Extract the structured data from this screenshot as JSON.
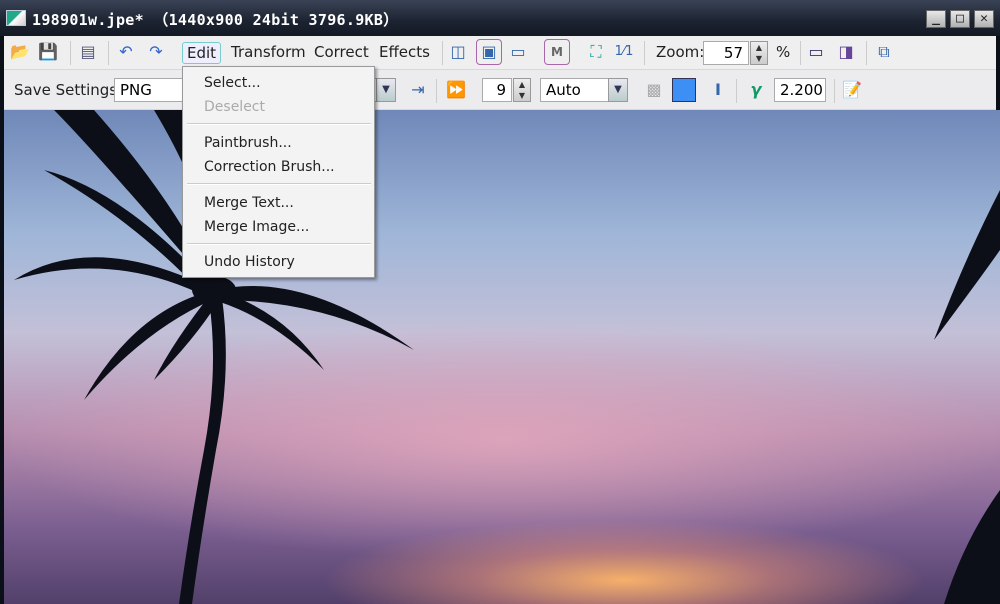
{
  "window": {
    "title": "198901w.jpe* （1440x900  24bit  3796.9KB）",
    "minimize": "_",
    "maximize": "□",
    "close": "✕"
  },
  "menubar": {
    "edit": "Edit",
    "transform": "Transform",
    "correct": "Correct",
    "effects": "Effects"
  },
  "toolbar": {
    "zoom_label": "Zoom:",
    "zoom_value": "57",
    "zoom_unit": "%",
    "m_label": "M",
    "one_to_one": "1⁄1"
  },
  "save_bar": {
    "label": "Save Settings",
    "format": "PNG",
    "quality": "9",
    "mode": "Auto",
    "gamma": "2.200",
    "color": "#3d8ef5"
  },
  "edit_menu": {
    "items": [
      {
        "label": "Select...",
        "enabled": true
      },
      {
        "label": "Deselect",
        "enabled": false
      },
      {
        "label": "Paintbrush...",
        "enabled": true
      },
      {
        "label": "Correction Brush...",
        "enabled": true
      },
      {
        "label": "Merge Text...",
        "enabled": true
      },
      {
        "label": "Merge Image...",
        "enabled": true
      },
      {
        "label": "Undo History",
        "enabled": true
      }
    ]
  }
}
